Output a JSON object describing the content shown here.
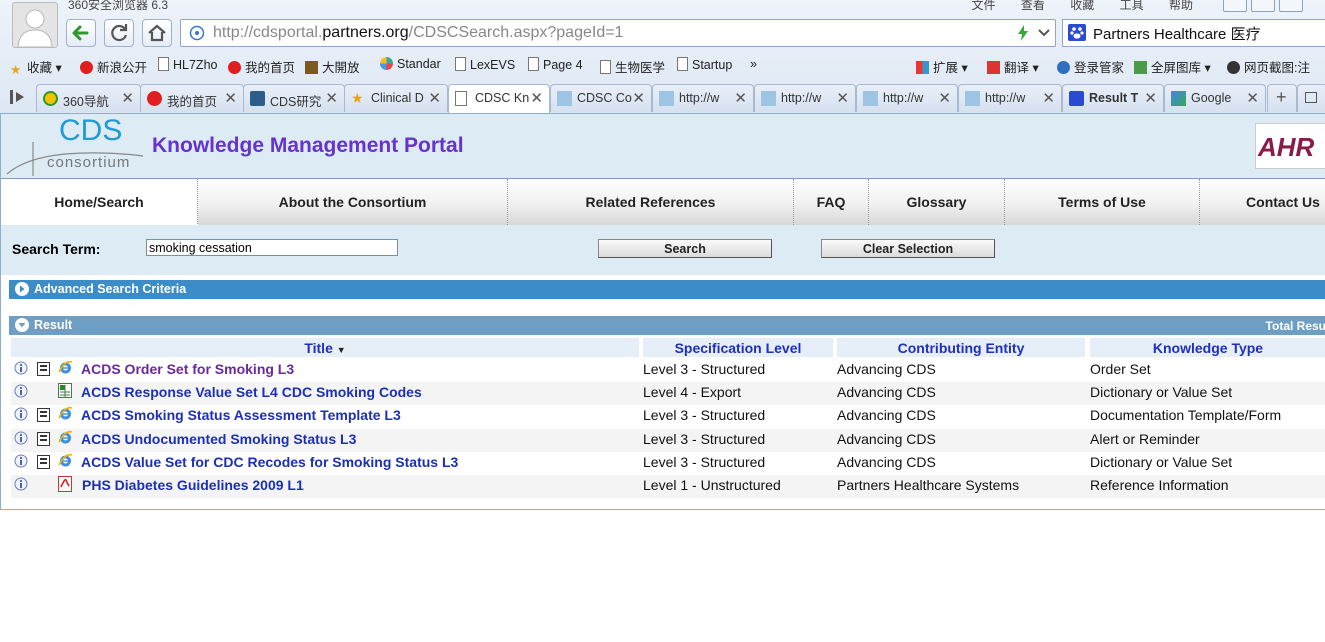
{
  "browser": {
    "title": "360安全浏览器 6.3",
    "menu": [
      "文件",
      "查看",
      "收藏",
      "工具",
      "帮助"
    ],
    "url_prefix": "http://cdsportal.",
    "url_domain": "partners.org",
    "url_path": "/CDSCSearch.aspx?pageId=1",
    "search_text": "Partners Healthcare 医疗",
    "bookmarks": [
      "收藏",
      "新浪公开",
      "HL7Zho",
      "我的首页",
      "大開放",
      "Standar",
      "LexEVS",
      "Page 4",
      "生物医学",
      "Startup",
      "»",
      "扩展",
      "翻译",
      "登录管家",
      "全屏图库",
      "网页截图:注"
    ],
    "tabs": [
      "360导航",
      "我的首页",
      "CDS研究",
      "Clinical D",
      "CDSC Kn",
      "CDSC Co",
      "http://w",
      "http://w",
      "http://w",
      "http://w",
      "Result T",
      "Google"
    ]
  },
  "header": {
    "logo_top": "CDS",
    "logo_bottom": "consortium",
    "title": "Knowledge Management Portal",
    "ahrq": "AHR"
  },
  "nav": {
    "items": [
      "Home/Search",
      "About the Consortium",
      "Related References",
      "FAQ",
      "Glossary",
      "Terms of Use",
      "Contact Us"
    ],
    "active_index": 0
  },
  "search": {
    "label": "Search Term:",
    "value": "smoking cessation",
    "search_button": "Search",
    "clear_button": "Clear Selection"
  },
  "advanced": {
    "label": "Advanced Search Criteria"
  },
  "result": {
    "label": "Result",
    "total": "Total Resu",
    "sort_indicator": "▼",
    "columns": [
      "Title",
      "Specification Level",
      "Contributing Entity",
      "Knowledge Type"
    ],
    "rows": [
      {
        "title": "ACDS Order Set for Smoking L3",
        "level": "Level 3 - Structured",
        "entity": "Advancing CDS",
        "type": "Order Set",
        "icons": "doc-ie",
        "visited": true
      },
      {
        "title": "ACDS Response Value Set L4 CDC Smoking Codes",
        "level": "Level 4 - Export",
        "entity": "Advancing CDS",
        "type": "Dictionary or Value Set",
        "icons": "xls",
        "visited": false
      },
      {
        "title": "ACDS Smoking Status Assessment Template L3",
        "level": "Level 3 - Structured",
        "entity": "Advancing CDS",
        "type": "Documentation Template/Form",
        "icons": "doc-ie",
        "visited": false
      },
      {
        "title": "ACDS Undocumented Smoking Status L3",
        "level": "Level 3 - Structured",
        "entity": "Advancing CDS",
        "type": "Alert or Reminder",
        "icons": "doc-ie",
        "visited": false
      },
      {
        "title": "ACDS Value Set for CDC Recodes for Smoking Status L3",
        "level": "Level 3 - Structured",
        "entity": "Advancing CDS",
        "type": "Dictionary or Value Set",
        "icons": "doc-ie",
        "visited": false
      },
      {
        "title": "PHS Diabetes Guidelines 2009 L1",
        "level": "Level 1 - Unstructured",
        "entity": "Partners Healthcare Systems",
        "type": "Reference Information",
        "icons": "pdf",
        "visited": false
      }
    ]
  },
  "colors": {
    "portal_title": "#6633cc",
    "link": "#1c2fb8",
    "visited_link": "#6a2a9a",
    "adv_bar": "#3c8cc8",
    "result_bar": "#6e9ec4",
    "header_bg": "#ddebf4"
  }
}
